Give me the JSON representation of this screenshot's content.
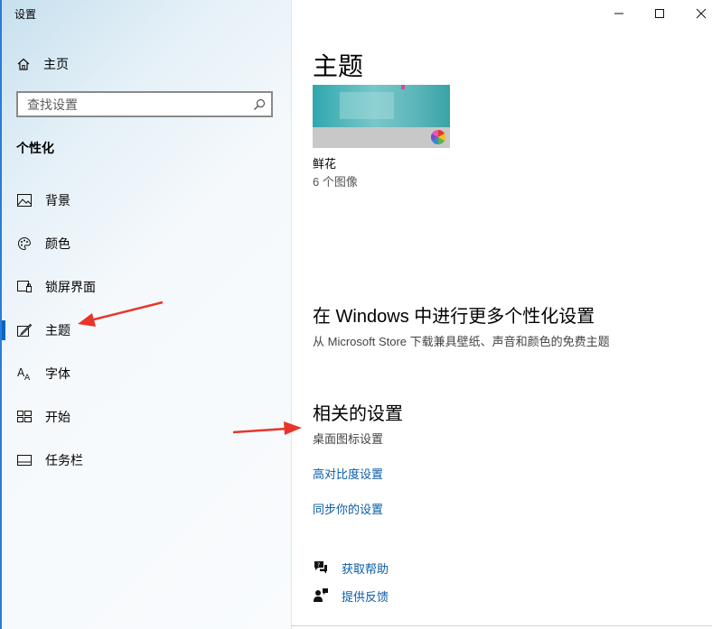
{
  "app": {
    "title": "设置"
  },
  "sidebar": {
    "home_label": "主页",
    "search_placeholder": "查找设置",
    "section_title": "个性化",
    "items": [
      {
        "label": "背景",
        "icon": "picture-icon"
      },
      {
        "label": "颜色",
        "icon": "palette-icon"
      },
      {
        "label": "锁屏界面",
        "icon": "lock-screen-icon"
      },
      {
        "label": "主题",
        "icon": "theme-icon",
        "active": true
      },
      {
        "label": "字体",
        "icon": "font-icon"
      },
      {
        "label": "开始",
        "icon": "start-icon"
      },
      {
        "label": "任务栏",
        "icon": "taskbar-icon"
      }
    ]
  },
  "window_controls": [
    "minimize",
    "maximize",
    "close"
  ],
  "main": {
    "title": "主题",
    "theme": {
      "name": "鲜花",
      "count": "6 个图像"
    },
    "more": {
      "heading": "在 Windows 中进行更多个性化设置",
      "description": "从 Microsoft Store 下载兼具壁纸、声音和颜色的免费主题"
    },
    "related": {
      "heading": "相关的设置",
      "desktop_icons": "桌面图标设置",
      "contrast": "高对比度设置",
      "sync": "同步你的设置"
    },
    "help": {
      "get_help": "获取帮助",
      "feedback": "提供反馈"
    }
  },
  "colors": {
    "accent": "#0a64c8",
    "link": "#0a5ea8",
    "annotation": "#e8352b"
  }
}
